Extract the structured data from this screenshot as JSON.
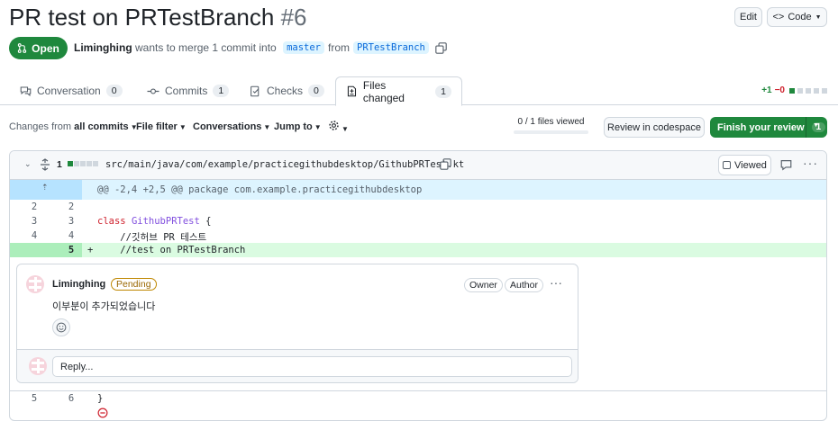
{
  "pr": {
    "title": "PR test on PRTestBranch",
    "number": "#6",
    "status": "Open",
    "author": "Liminghing",
    "merge_text": "wants to merge 1 commit into",
    "base_branch": "master",
    "from_text": "from",
    "head_branch": "PRTestBranch"
  },
  "header_buttons": {
    "edit": "Edit",
    "code": "Code"
  },
  "tabs": [
    {
      "label": "Conversation",
      "count": "0"
    },
    {
      "label": "Commits",
      "count": "1"
    },
    {
      "label": "Checks",
      "count": "0"
    },
    {
      "label": "Files changed",
      "count": "1"
    }
  ],
  "diffstat": {
    "additions": "+1",
    "deletions": "−0"
  },
  "toolbar": {
    "changes_from": "Changes from",
    "all_commits": "all commits",
    "file_filter": "File filter",
    "conversations": "Conversations",
    "jump_to": "Jump to",
    "files_viewed": "0 / 1 files viewed",
    "review_codespace": "Review in codespace",
    "finish_review": "Finish your review",
    "finish_count": "1"
  },
  "file": {
    "changes": "1",
    "path": "src/main/java/com/example/practicegithubdesktop/GithubPRTest.kt",
    "viewed_label": "Viewed",
    "hunk": "@@ -2,4 +2,5 @@ package com.example.practicegithubdesktop",
    "lines": [
      {
        "old": "2",
        "new": "2",
        "sign": "",
        "code": ""
      },
      {
        "old": "3",
        "new": "3",
        "sign": "",
        "kw": "class",
        "cls": "GithubPRTest",
        "rest": " {"
      },
      {
        "old": "4",
        "new": "4",
        "sign": "",
        "code": "    //깃허브 PR 테스트"
      },
      {
        "old": "",
        "new": "5",
        "sign": "+",
        "code": "    //test on PRTestBranch"
      },
      {
        "old": "5",
        "new": "6",
        "sign": "",
        "code": "}"
      }
    ]
  },
  "comment": {
    "author": "Liminghing",
    "badge": "Pending",
    "owner": "Owner",
    "author_label": "Author",
    "body": "이부분이 추가되었습니다",
    "reply_placeholder": "Reply..."
  },
  "colors": {
    "green": "#1f883d",
    "red": "#cf222e",
    "accent_blue": "#0969da",
    "addition_bg": "#dafbe1",
    "hunk_bg": "#ddf4ff"
  }
}
